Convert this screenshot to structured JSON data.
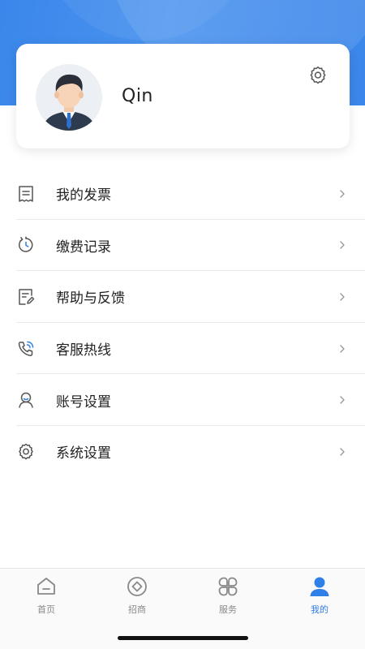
{
  "profile": {
    "username": "Qin",
    "settings_icon": "gear-icon",
    "avatar": "businessman-avatar"
  },
  "menu": {
    "items": [
      {
        "label": "我的发票",
        "icon": "invoice-icon"
      },
      {
        "label": "缴费记录",
        "icon": "history-icon"
      },
      {
        "label": "帮助与反馈",
        "icon": "feedback-icon"
      },
      {
        "label": "客服热线",
        "icon": "phone-icon"
      },
      {
        "label": "账号设置",
        "icon": "account-icon"
      },
      {
        "label": "系统设置",
        "icon": "gear-icon"
      }
    ]
  },
  "tabbar": {
    "tabs": [
      {
        "label": "首页",
        "icon": "home-icon",
        "active": false
      },
      {
        "label": "招商",
        "icon": "coin-icon",
        "active": false
      },
      {
        "label": "服务",
        "icon": "grid-icon",
        "active": false
      },
      {
        "label": "我的",
        "icon": "user-icon",
        "active": true
      }
    ]
  },
  "colors": {
    "accent": "#2f7fe6",
    "header_gradient_start": "#3a86ea",
    "icon_gray": "#555555",
    "inactive_tab": "#888888"
  }
}
